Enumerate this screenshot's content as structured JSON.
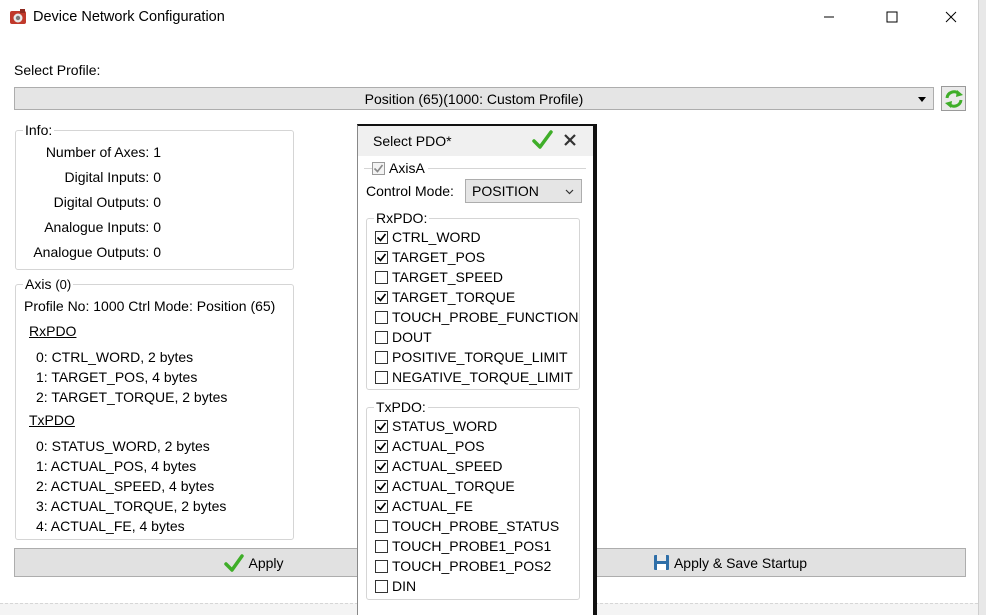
{
  "window": {
    "title": "Device Network Configuration"
  },
  "profile": {
    "label": "Select Profile:",
    "selected": "Position (65)(1000: Custom Profile)"
  },
  "info": {
    "legend": "Info:",
    "rows": [
      {
        "label": "Number of Axes:",
        "value": "1"
      },
      {
        "label": "Digital Inputs:",
        "value": "0"
      },
      {
        "label": "Digital Outputs:",
        "value": "0"
      },
      {
        "label": "Analogue Inputs:",
        "value": "0"
      },
      {
        "label": "Analogue Outputs:",
        "value": "0"
      }
    ]
  },
  "axis": {
    "legend": "Axis",
    "legend_index": "(0)",
    "profile_line": "Profile No: 1000 Ctrl Mode: Position (65)",
    "rxpdo_title": "RxPDO",
    "rxpdo": [
      "0: CTRL_WORD, 2 bytes",
      "1: TARGET_POS, 4 bytes",
      "2: TARGET_TORQUE, 2 bytes"
    ],
    "txpdo_title": "TxPDO",
    "txpdo": [
      "0: STATUS_WORD, 2 bytes",
      "1: ACTUAL_POS, 4 bytes",
      "2: ACTUAL_SPEED, 4 bytes",
      "3: ACTUAL_TORQUE, 2 bytes",
      "4: ACTUAL_FE, 4 bytes"
    ]
  },
  "buttons": {
    "apply": "Apply",
    "apply_save": "Apply & Save Startup"
  },
  "popup": {
    "title": "Select PDO*",
    "axis_label": "AxisA",
    "axis_checked": true,
    "control_mode_label": "Control Mode:",
    "control_mode_value": "POSITION",
    "rx_legend": "RxPDO:",
    "rx_items": [
      {
        "label": "CTRL_WORD",
        "checked": true
      },
      {
        "label": "TARGET_POS",
        "checked": true
      },
      {
        "label": "TARGET_SPEED",
        "checked": false
      },
      {
        "label": "TARGET_TORQUE",
        "checked": true
      },
      {
        "label": "TOUCH_PROBE_FUNCTION",
        "checked": false
      },
      {
        "label": "DOUT",
        "checked": false
      },
      {
        "label": "POSITIVE_TORQUE_LIMIT",
        "checked": false
      },
      {
        "label": "NEGATIVE_TORQUE_LIMIT",
        "checked": false
      }
    ],
    "tx_legend": "TxPDO:",
    "tx_items": [
      {
        "label": "STATUS_WORD",
        "checked": true
      },
      {
        "label": "ACTUAL_POS",
        "checked": true
      },
      {
        "label": "ACTUAL_SPEED",
        "checked": true
      },
      {
        "label": "ACTUAL_TORQUE",
        "checked": true
      },
      {
        "label": "ACTUAL_FE",
        "checked": true
      },
      {
        "label": "TOUCH_PROBE_STATUS",
        "checked": false
      },
      {
        "label": "TOUCH_PROBE1_POS1",
        "checked": false
      },
      {
        "label": "TOUCH_PROBE1_POS2",
        "checked": false
      },
      {
        "label": "DIN",
        "checked": false
      }
    ]
  },
  "icons": {
    "app": "app-icon",
    "minimize": "minimize-icon",
    "maximize": "maximize-icon",
    "close": "close-icon",
    "refresh": "refresh-icon",
    "dropdown": "chevron-down-icon",
    "confirm": "checkmark-icon",
    "cancel": "close-icon",
    "save": "floppy-disk-icon"
  },
  "colors": {
    "accent_green": "#3fae29",
    "button_bg": "#e1e1e1",
    "popup_border": "#111111"
  }
}
